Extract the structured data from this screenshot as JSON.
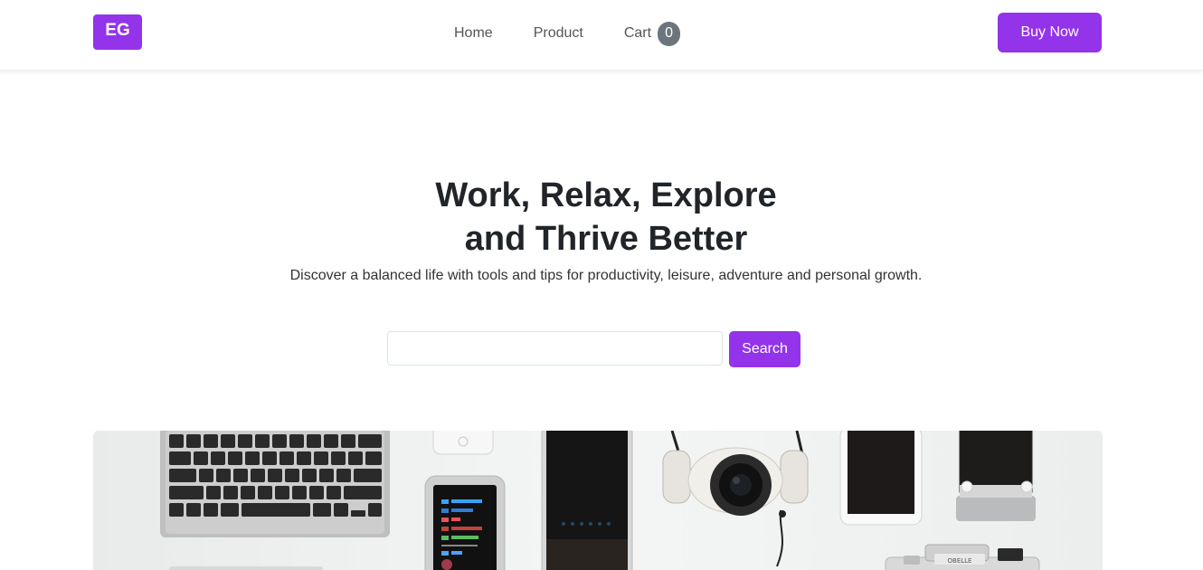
{
  "navbar": {
    "logo_text": "EG",
    "links": [
      {
        "label": "Home"
      },
      {
        "label": "Product"
      },
      {
        "label": "Cart"
      }
    ],
    "cart_count": "0",
    "buy_label": "Buy Now"
  },
  "hero": {
    "title_line1": "Work, Relax, Explore",
    "title_line2": "and Thrive Better",
    "subtitle": "Discover a balanced life with tools and tips for productivity, leisure, adventure and personal growth."
  },
  "search": {
    "value": "",
    "placeholder": "",
    "button_label": "Search"
  },
  "colors": {
    "accent": "#9333ea",
    "badge": "#6c757d",
    "text": "#212529"
  },
  "hero_image": {
    "icon": "flat-lay-devices-photo",
    "camera_brand": "OBELLE"
  }
}
